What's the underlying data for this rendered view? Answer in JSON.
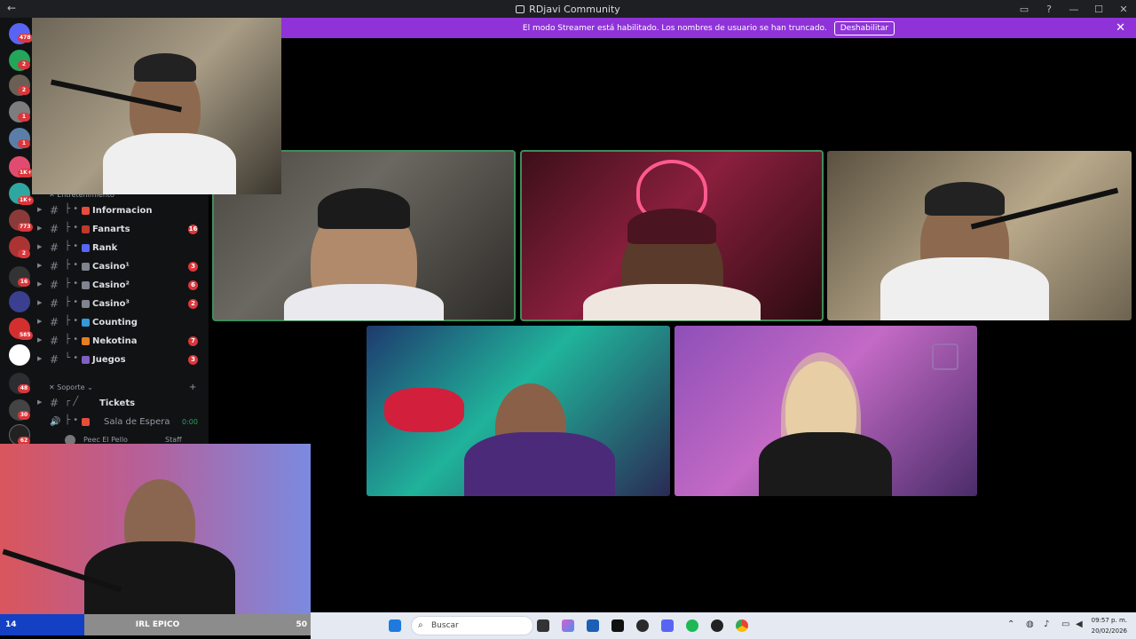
{
  "window": {
    "title": "RDjavi Community",
    "back_icon": "arrow-left-icon"
  },
  "banner": {
    "text": "El modo Streamer está habilitado. Los nombres de usuario se han truncado.",
    "button_label": "Deshabilitar",
    "color": "#8f33d9"
  },
  "server_rail": {
    "badges": [
      "478",
      "2",
      "2",
      "1",
      "1",
      "1K+",
      "1K+",
      "773",
      "2",
      "16",
      "585",
      "48",
      "30",
      "62"
    ]
  },
  "channels": {
    "category_entretenimiento": "Entretenimiento",
    "category_soporte": "Soporte",
    "items": [
      {
        "label": "Informacion",
        "count": ""
      },
      {
        "label": "Fanarts",
        "count": "16"
      },
      {
        "label": "Rank",
        "count": ""
      },
      {
        "label": "Casino¹",
        "count": "3"
      },
      {
        "label": "Casino²",
        "count": "6"
      },
      {
        "label": "Casino³",
        "count": "2"
      },
      {
        "label": "Counting",
        "count": ""
      },
      {
        "label": "Nekotina",
        "count": "7"
      },
      {
        "label": "Juegos",
        "count": "3"
      }
    ],
    "tickets": "Tickets",
    "voice_channel": "Sala de Espera",
    "voice_time": "0:00",
    "voice_user": "Peec El Pello",
    "voice_user_role": "Staff"
  },
  "overlay": {
    "irl_left": "14",
    "irl_title": "IRL EPICO",
    "irl_right": "50"
  },
  "taskbar": {
    "search_placeholder": "Buscar",
    "time": "09:57 p. m.",
    "date": "20/02/2026"
  },
  "colors": {
    "speaking_outline": "#3e8e5a",
    "badge_red": "#da373c",
    "irl_blue": "#1440c4"
  }
}
